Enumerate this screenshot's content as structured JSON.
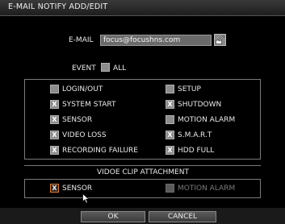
{
  "dialog": {
    "title": "E-MAIL NOTIFY ADD/EDIT"
  },
  "email": {
    "label": "E-MAIL",
    "value": "focus@focushns.com",
    "keyboard_icon": "pencil-keyboard-icon"
  },
  "event": {
    "label": "EVENT",
    "all_label": "ALL",
    "all_checked": false
  },
  "events": [
    {
      "label": "LOGIN/OUT",
      "checked": false
    },
    {
      "label": "SETUP",
      "checked": false
    },
    {
      "label": "SYSTEM START",
      "checked": true
    },
    {
      "label": "SHUTDOWN",
      "checked": true
    },
    {
      "label": "SENSOR",
      "checked": true
    },
    {
      "label": "MOTION ALARM",
      "checked": false
    },
    {
      "label": "VIDEO LOSS",
      "checked": true
    },
    {
      "label": "S.M.A.R.T",
      "checked": true
    },
    {
      "label": "RECORDING FAILURE",
      "checked": true
    },
    {
      "label": "HDD FULL",
      "checked": true
    }
  ],
  "attachment": {
    "title": "VIDOE CLIP ATTACHMENT",
    "sensor": {
      "label": "SENSOR",
      "checked": true
    },
    "motion": {
      "label": "MOTION ALARM",
      "checked": false
    }
  },
  "buttons": {
    "ok": "OK",
    "cancel": "CANCEL"
  },
  "check_mark": "X",
  "colors": {
    "focus": "#e07a2c",
    "checkbox": "#8c8c8c"
  }
}
